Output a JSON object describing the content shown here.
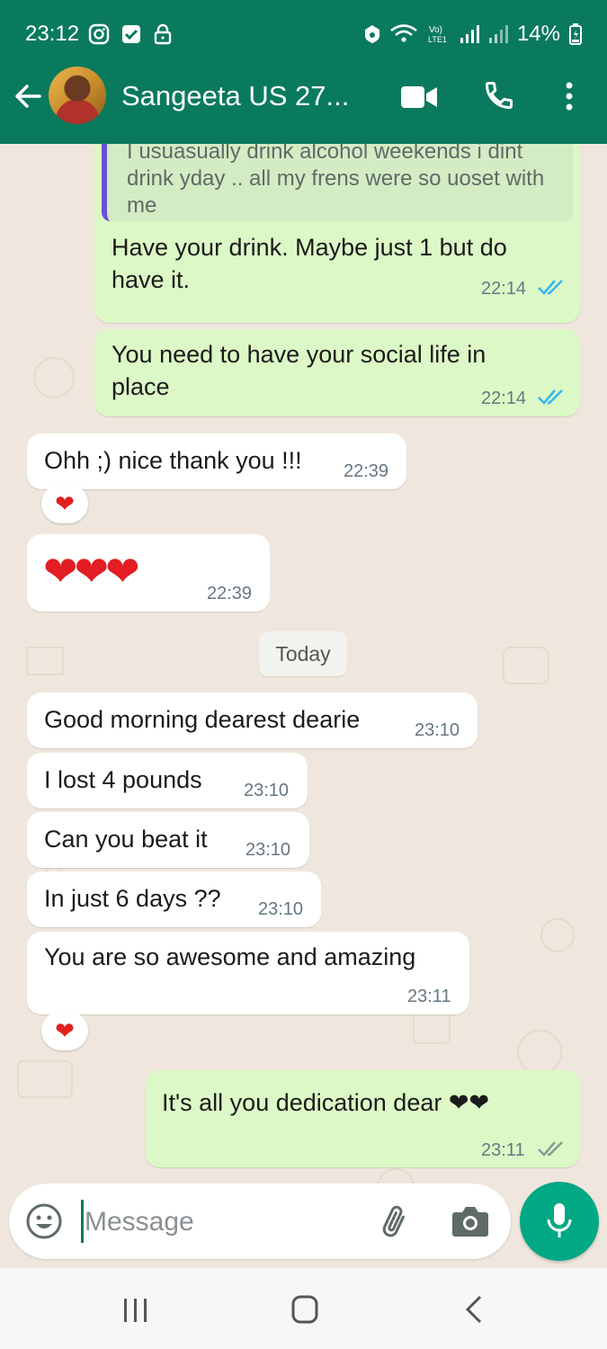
{
  "status_bar": {
    "time": "23:12",
    "battery": "14%",
    "icons": [
      "instagram-icon",
      "check-box-icon",
      "lock-icon",
      "data-saver-icon",
      "wifi-calling-icon",
      "volte-icon",
      "signal-icon",
      "signal-icon",
      "battery-charging-icon"
    ]
  },
  "header": {
    "contact_name": "Sangeeta US 27...",
    "icons": [
      "back-arrow-icon",
      "avatar",
      "video-call-icon",
      "voice-call-icon",
      "more-options-icon"
    ]
  },
  "messages": [
    {
      "direction": "out",
      "quoted_text": "I usuasually drink alcohol weekends i dint drink yday .. all my frens were so uoset with me",
      "text_line1": "Have your drink. Maybe just 1 but do",
      "text_line2": "have it.",
      "time": "22:14",
      "status": "read"
    },
    {
      "direction": "out",
      "text_line1": "You need to have your social life in",
      "text_line2": "place",
      "time": "22:14",
      "status": "read"
    },
    {
      "direction": "in",
      "text": "Ohh ;) nice thank you !!!",
      "time": "22:39",
      "reaction": "❤"
    },
    {
      "direction": "in",
      "text": "❤❤❤",
      "time": "22:39"
    },
    {
      "direction": "in",
      "text": "Good morning dearest dearie",
      "time": "23:10"
    },
    {
      "direction": "in",
      "text": "I lost 4 pounds",
      "time": "23:10"
    },
    {
      "direction": "in",
      "text": "Can you beat it",
      "time": "23:10"
    },
    {
      "direction": "in",
      "text": "In just 6 days ??",
      "time": "23:10"
    },
    {
      "direction": "in",
      "text": "You are so awesome and amazing",
      "time": "23:11",
      "reaction": "❤"
    },
    {
      "direction": "out",
      "text": "It's all you dedication dear ❤❤",
      "time": "23:11",
      "status": "delivered"
    }
  ],
  "date_separator": "Today",
  "composer": {
    "placeholder": "Message"
  },
  "colors": {
    "header": "#0a7a5e",
    "outgoing_bubble": "#dcf8c6",
    "incoming_bubble": "#ffffff",
    "chat_background": "#efe7dd",
    "read_ticks": "#34b7f1",
    "mic_button": "#00a884"
  }
}
